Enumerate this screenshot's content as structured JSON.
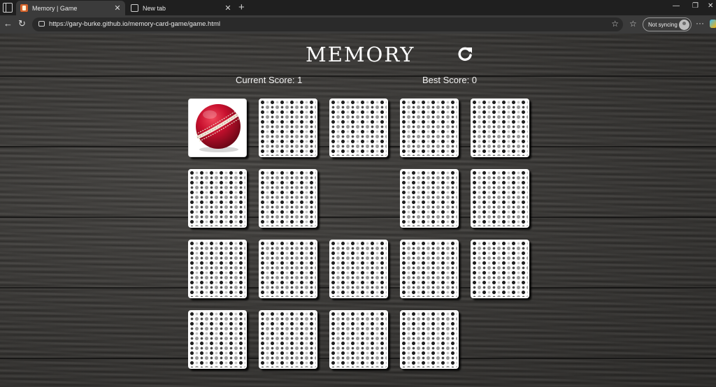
{
  "browser": {
    "tabs": [
      {
        "title": "Memory | Game",
        "favicon": "memory-game-favicon",
        "active": true
      },
      {
        "title": "New tab",
        "favicon": "new-tab-favicon",
        "active": false
      }
    ],
    "url": "https://gary-burke.github.io/memory-card-game/game.html",
    "profile_label": "Not syncing"
  },
  "game": {
    "title": "MEMORY",
    "current_score_label": "Current Score: 1",
    "best_score_label": "Best Score: 0",
    "reset_icon": "refresh-icon",
    "face_up_card": "cricket-ball",
    "colors": {
      "ball_red": "#c8102e",
      "seam": "#f1e6d8",
      "card_back": "#fbfbfb"
    }
  }
}
